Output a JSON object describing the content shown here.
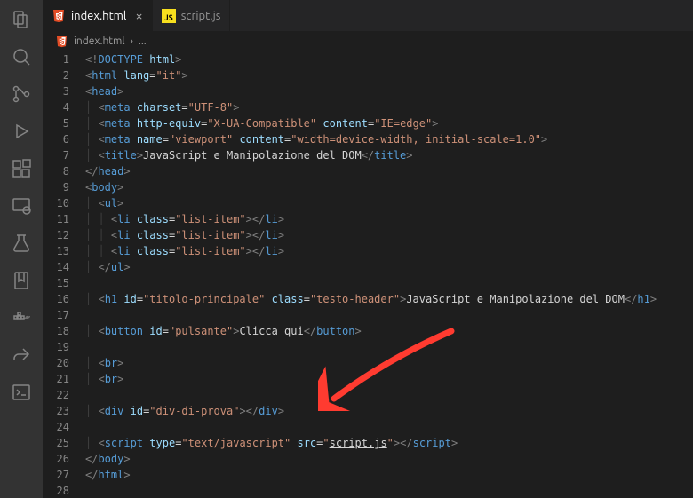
{
  "tabs": [
    {
      "label": "index.html",
      "icon": "html5",
      "active": true,
      "close": true
    },
    {
      "label": "script.js",
      "icon": "js",
      "active": false,
      "close": false
    }
  ],
  "breadcrumb": {
    "file": "index.html",
    "sep": "›",
    "rest": "..."
  },
  "colors": {
    "arrow": "#ff3b30"
  },
  "code": {
    "lines": [
      [
        {
          "t": "<!",
          "c": "punc"
        },
        {
          "t": "DOCTYPE",
          "c": "tag"
        },
        {
          "t": " ",
          "c": "txt"
        },
        {
          "t": "html",
          "c": "attr"
        },
        {
          "t": ">",
          "c": "punc"
        }
      ],
      [
        {
          "t": "<",
          "c": "punc"
        },
        {
          "t": "html",
          "c": "tag"
        },
        {
          "t": " ",
          "c": "txt"
        },
        {
          "t": "lang",
          "c": "attr"
        },
        {
          "t": "=",
          "c": "txt"
        },
        {
          "t": "\"it\"",
          "c": "str"
        },
        {
          "t": ">",
          "c": "punc"
        }
      ],
      [
        {
          "t": "<",
          "c": "punc"
        },
        {
          "t": "head",
          "c": "tag"
        },
        {
          "t": ">",
          "c": "punc"
        }
      ],
      [
        {
          "g": 1
        },
        {
          "t": "<",
          "c": "punc"
        },
        {
          "t": "meta",
          "c": "tag"
        },
        {
          "t": " ",
          "c": "txt"
        },
        {
          "t": "charset",
          "c": "attr"
        },
        {
          "t": "=",
          "c": "txt"
        },
        {
          "t": "\"UTF-8\"",
          "c": "str"
        },
        {
          "t": ">",
          "c": "punc"
        }
      ],
      [
        {
          "g": 1
        },
        {
          "t": "<",
          "c": "punc"
        },
        {
          "t": "meta",
          "c": "tag"
        },
        {
          "t": " ",
          "c": "txt"
        },
        {
          "t": "http-equiv",
          "c": "attr"
        },
        {
          "t": "=",
          "c": "txt"
        },
        {
          "t": "\"X-UA-Compatible\"",
          "c": "str"
        },
        {
          "t": " ",
          "c": "txt"
        },
        {
          "t": "content",
          "c": "attr"
        },
        {
          "t": "=",
          "c": "txt"
        },
        {
          "t": "\"IE=edge\"",
          "c": "str"
        },
        {
          "t": ">",
          "c": "punc"
        }
      ],
      [
        {
          "g": 1
        },
        {
          "t": "<",
          "c": "punc"
        },
        {
          "t": "meta",
          "c": "tag"
        },
        {
          "t": " ",
          "c": "txt"
        },
        {
          "t": "name",
          "c": "attr"
        },
        {
          "t": "=",
          "c": "txt"
        },
        {
          "t": "\"viewport\"",
          "c": "str"
        },
        {
          "t": " ",
          "c": "txt"
        },
        {
          "t": "content",
          "c": "attr"
        },
        {
          "t": "=",
          "c": "txt"
        },
        {
          "t": "\"width=device-width, initial-scale=1.0\"",
          "c": "str"
        },
        {
          "t": ">",
          "c": "punc"
        }
      ],
      [
        {
          "g": 1
        },
        {
          "t": "<",
          "c": "punc"
        },
        {
          "t": "title",
          "c": "tag"
        },
        {
          "t": ">",
          "c": "punc"
        },
        {
          "t": "JavaScript e Manipolazione del DOM",
          "c": "txt"
        },
        {
          "t": "</",
          "c": "punc"
        },
        {
          "t": "title",
          "c": "tag"
        },
        {
          "t": ">",
          "c": "punc"
        }
      ],
      [
        {
          "t": "</",
          "c": "punc"
        },
        {
          "t": "head",
          "c": "tag"
        },
        {
          "t": ">",
          "c": "punc"
        }
      ],
      [
        {
          "t": "<",
          "c": "punc"
        },
        {
          "t": "body",
          "c": "tag"
        },
        {
          "t": ">",
          "c": "punc"
        }
      ],
      [
        {
          "g": 1
        },
        {
          "t": "<",
          "c": "punc"
        },
        {
          "t": "ul",
          "c": "tag"
        },
        {
          "t": ">",
          "c": "punc"
        }
      ],
      [
        {
          "g": 2
        },
        {
          "t": "<",
          "c": "punc"
        },
        {
          "t": "li",
          "c": "tag"
        },
        {
          "t": " ",
          "c": "txt"
        },
        {
          "t": "class",
          "c": "attr"
        },
        {
          "t": "=",
          "c": "txt"
        },
        {
          "t": "\"list-item\"",
          "c": "str"
        },
        {
          "t": "></",
          "c": "punc"
        },
        {
          "t": "li",
          "c": "tag"
        },
        {
          "t": ">",
          "c": "punc"
        }
      ],
      [
        {
          "g": 2
        },
        {
          "t": "<",
          "c": "punc"
        },
        {
          "t": "li",
          "c": "tag"
        },
        {
          "t": " ",
          "c": "txt"
        },
        {
          "t": "class",
          "c": "attr"
        },
        {
          "t": "=",
          "c": "txt"
        },
        {
          "t": "\"list-item\"",
          "c": "str"
        },
        {
          "t": "></",
          "c": "punc"
        },
        {
          "t": "li",
          "c": "tag"
        },
        {
          "t": ">",
          "c": "punc"
        }
      ],
      [
        {
          "g": 2
        },
        {
          "t": "<",
          "c": "punc"
        },
        {
          "t": "li",
          "c": "tag"
        },
        {
          "t": " ",
          "c": "txt"
        },
        {
          "t": "class",
          "c": "attr"
        },
        {
          "t": "=",
          "c": "txt"
        },
        {
          "t": "\"list-item\"",
          "c": "str"
        },
        {
          "t": "></",
          "c": "punc"
        },
        {
          "t": "li",
          "c": "tag"
        },
        {
          "t": ">",
          "c": "punc"
        }
      ],
      [
        {
          "g": 1
        },
        {
          "t": "</",
          "c": "punc"
        },
        {
          "t": "ul",
          "c": "tag"
        },
        {
          "t": ">",
          "c": "punc"
        }
      ],
      [],
      [
        {
          "g": 1
        },
        {
          "t": "<",
          "c": "punc"
        },
        {
          "t": "h1",
          "c": "tag"
        },
        {
          "t": " ",
          "c": "txt"
        },
        {
          "t": "id",
          "c": "attr"
        },
        {
          "t": "=",
          "c": "txt"
        },
        {
          "t": "\"titolo-principale\"",
          "c": "str"
        },
        {
          "t": " ",
          "c": "txt"
        },
        {
          "t": "class",
          "c": "attr"
        },
        {
          "t": "=",
          "c": "txt"
        },
        {
          "t": "\"testo-header\"",
          "c": "str"
        },
        {
          "t": ">",
          "c": "punc"
        },
        {
          "t": "JavaScript e Manipolazione del DOM",
          "c": "txt"
        },
        {
          "t": "</",
          "c": "punc"
        },
        {
          "t": "h1",
          "c": "tag"
        },
        {
          "t": ">",
          "c": "punc"
        }
      ],
      [],
      [
        {
          "g": 1
        },
        {
          "t": "<",
          "c": "punc"
        },
        {
          "t": "button",
          "c": "tag"
        },
        {
          "t": " ",
          "c": "txt"
        },
        {
          "t": "id",
          "c": "attr"
        },
        {
          "t": "=",
          "c": "txt"
        },
        {
          "t": "\"pulsante\"",
          "c": "str"
        },
        {
          "t": ">",
          "c": "punc"
        },
        {
          "t": "Clicca qui",
          "c": "txt"
        },
        {
          "t": "</",
          "c": "punc"
        },
        {
          "t": "button",
          "c": "tag"
        },
        {
          "t": ">",
          "c": "punc"
        }
      ],
      [],
      [
        {
          "g": 1
        },
        {
          "t": "<",
          "c": "punc"
        },
        {
          "t": "br",
          "c": "tag"
        },
        {
          "t": ">",
          "c": "punc"
        }
      ],
      [
        {
          "g": 1
        },
        {
          "t": "<",
          "c": "punc"
        },
        {
          "t": "br",
          "c": "tag"
        },
        {
          "t": ">",
          "c": "punc"
        }
      ],
      [],
      [
        {
          "g": 1
        },
        {
          "t": "<",
          "c": "punc"
        },
        {
          "t": "div",
          "c": "tag"
        },
        {
          "t": " ",
          "c": "txt"
        },
        {
          "t": "id",
          "c": "attr"
        },
        {
          "t": "=",
          "c": "txt"
        },
        {
          "t": "\"div-di-prova\"",
          "c": "str"
        },
        {
          "t": "></",
          "c": "punc"
        },
        {
          "t": "div",
          "c": "tag"
        },
        {
          "t": ">",
          "c": "punc"
        }
      ],
      [],
      [
        {
          "g": 1
        },
        {
          "t": "<",
          "c": "punc"
        },
        {
          "t": "script",
          "c": "tag"
        },
        {
          "t": " ",
          "c": "txt"
        },
        {
          "t": "type",
          "c": "attr"
        },
        {
          "t": "=",
          "c": "txt"
        },
        {
          "t": "\"text/javascript\"",
          "c": "str"
        },
        {
          "t": " ",
          "c": "txt"
        },
        {
          "t": "src",
          "c": "attr"
        },
        {
          "t": "=",
          "c": "txt"
        },
        {
          "t": "\"",
          "c": "str"
        },
        {
          "t": "script.js",
          "c": "link"
        },
        {
          "t": "\"",
          "c": "str"
        },
        {
          "t": "></",
          "c": "punc"
        },
        {
          "t": "script",
          "c": "tag"
        },
        {
          "t": ">",
          "c": "punc"
        }
      ],
      [
        {
          "t": "</",
          "c": "punc"
        },
        {
          "t": "body",
          "c": "tag"
        },
        {
          "t": ">",
          "c": "punc"
        }
      ],
      [
        {
          "t": "</",
          "c": "punc"
        },
        {
          "t": "html",
          "c": "tag"
        },
        {
          "t": ">",
          "c": "punc"
        }
      ],
      []
    ]
  }
}
